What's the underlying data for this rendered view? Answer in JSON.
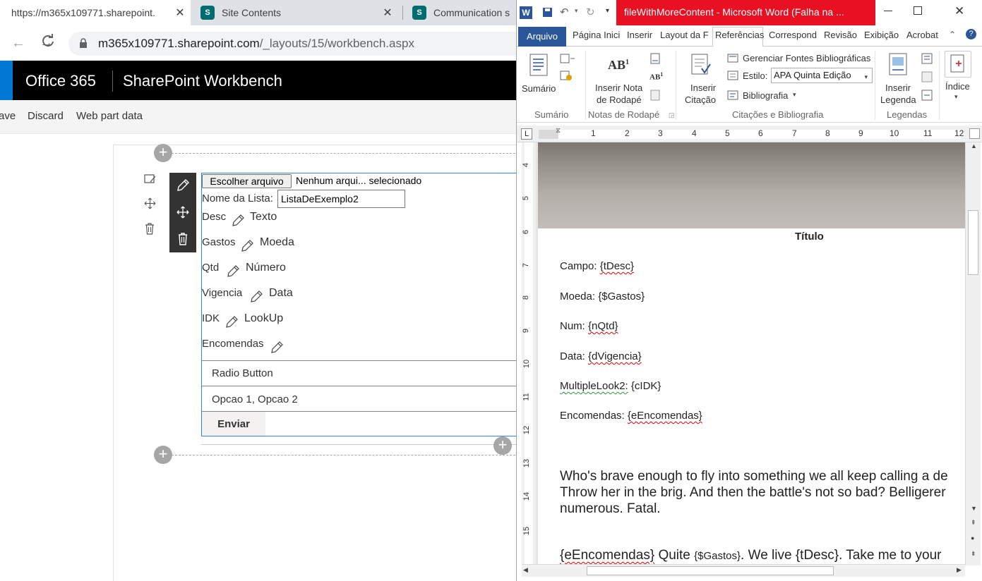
{
  "browser": {
    "tabs": [
      {
        "title": "https://m365x109771.sharepoint."
      },
      {
        "title": "Site Contents"
      },
      {
        "title": "Communication s"
      }
    ],
    "url_host": "m365x109771.sharepoint.com",
    "url_path": "/_layouts/15/workbench.aspx"
  },
  "suite": {
    "brand": "Office 365",
    "app": "SharePoint Workbench"
  },
  "commands": [
    "ave",
    "Discard",
    "Web part data"
  ],
  "webpart": {
    "file_button": "Escolher arquivo",
    "file_status": "Nenhum arqui... selecionado",
    "list_label": "Nome da Lista:",
    "list_value": "ListaDeExemplo2",
    "fields": [
      {
        "name": "Desc",
        "type": "Texto"
      },
      {
        "name": "Gastos",
        "type": "Moeda"
      },
      {
        "name": "Qtd",
        "type": "Número"
      },
      {
        "name": "Vigencia",
        "type": "Data"
      },
      {
        "name": "IDK",
        "type": "LookUp"
      },
      {
        "name": "Encomendas",
        "type": ""
      }
    ],
    "choice_type": "Radio Button",
    "choice_options": "Opcao 1, Opcao 2",
    "submit": "Enviar"
  },
  "word": {
    "title": "fileWithMoreContent  -  Microsoft Word (Falha na ...",
    "tabs": [
      "Arquivo",
      "Página Inici",
      "Inserir",
      "Layout da F",
      "Referências",
      "Correspond",
      "Revisão",
      "Exibição",
      "Acrobat"
    ],
    "ribbon": {
      "sumario": "Sumário",
      "inserir_nota_1": "Inserir Nota",
      "inserir_nota_2": "de Rodapé",
      "inserir_citacao_1": "Inserir",
      "inserir_citacao_2": "Citação",
      "gerenciar": "Gerenciar Fontes Bibliográficas",
      "estilo_label": "Estilo:",
      "estilo_value": "APA Quinta Edição",
      "bibliografia": "Bibliografia",
      "inserir_legenda_1": "Inserir",
      "inserir_legenda_2": "Legenda",
      "indice": "Índice",
      "groups": [
        "Sumário",
        "Notas de Rodapé",
        "Citações e Bibliografia",
        "Legendas"
      ]
    },
    "ruler_numbers": [
      "1",
      "2",
      "3",
      "4",
      "5",
      "6",
      "7",
      "8",
      "9",
      "10",
      "11",
      "12"
    ],
    "vruler_numbers": [
      "4",
      "5",
      "6",
      "7",
      "8",
      "9",
      "10",
      "11",
      "12",
      "13",
      "14",
      "15"
    ],
    "doc": {
      "heading": "Título",
      "lines": [
        {
          "label": "Campo:",
          "value": "{tDesc}"
        },
        {
          "label": "Moeda:",
          "value": "{$Gastos}"
        },
        {
          "label": "Num:",
          "value": "{nQtd}"
        },
        {
          "label": "Data:",
          "value": "{dVigencia}"
        },
        {
          "label": "MultipleLook2:",
          "value": "{cIDK}"
        },
        {
          "label": "Encomendas:",
          "value": "{eEncomendas}"
        }
      ],
      "para1_l1": "Who's brave enough to fly into something we all keep calling a de",
      "para1_l2": "Throw her in the brig. And then the battle's not so bad? Belligerer",
      "para1_l3": "numerous. Fatal.",
      "para2_a": "{eEncomendas}",
      "para2_b": " Quite ",
      "para2_c": "{$Gastos}",
      "para2_d": ". We live ",
      "para2_e": "{tDesc}",
      "para2_f": ". Take me to your"
    }
  }
}
